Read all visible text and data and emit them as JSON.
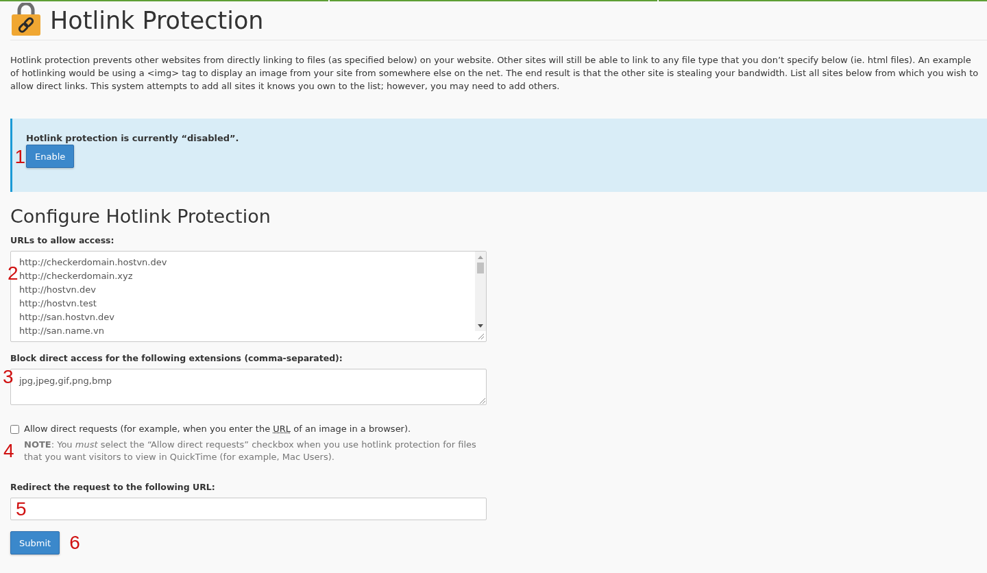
{
  "page": {
    "title": "Hotlink Protection",
    "description": "Hotlink protection prevents other websites from directly linking to files (as specified below) on your website. Other sites will still be able to link to any file type that you don’t specify below (ie. html files). An example of hotlinking would be using a <img> tag to display an image from your site from somewhere else on the net. The end result is that the other site is stealing your bandwidth. List all sites below from which you wish to allow direct links. This system attempts to add all sites it knows you own to the list; however, you may need to add others."
  },
  "status_alert": {
    "message": "Hotlink protection is currently “disabled”.",
    "button": {
      "label": "Enable",
      "marker": "1"
    }
  },
  "configure": {
    "heading": "Configure Hotlink Protection",
    "allowed_urls": {
      "label": "URLs to allow access:",
      "marker": "2",
      "urls": [
        "http://checkerdomain.hostvn.dev",
        "http://checkerdomain.xyz",
        "http://hostvn.dev",
        "http://hostvn.test",
        "http://san.hostvn.dev",
        "http://san.name.vn"
      ]
    },
    "extensions": {
      "label": "Block direct access for the following extensions (comma-separated):",
      "value": "jpg,jpeg,gif,png,bmp",
      "marker": "3"
    },
    "allow_direct": {
      "checked": false,
      "label_parts": [
        {
          "kind": "text",
          "text": "Allow direct requests (for example, when you enter the"
        },
        {
          "kind": "abbr",
          "text": "URL"
        },
        {
          "kind": "text",
          "text": "of an image in a browser)."
        }
      ],
      "note": "**NOTE**: You *must* select the “Allow direct requests” checkbox when you use hotlink protection for files that you want visitors to view in QuickTime (for example, Mac Users).",
      "marker": "4"
    },
    "redirect": {
      "label": "Redirect the request to the following URL:",
      "marker": "5"
    },
    "submit": {
      "label": "Submit",
      "marker": "6"
    }
  }
}
